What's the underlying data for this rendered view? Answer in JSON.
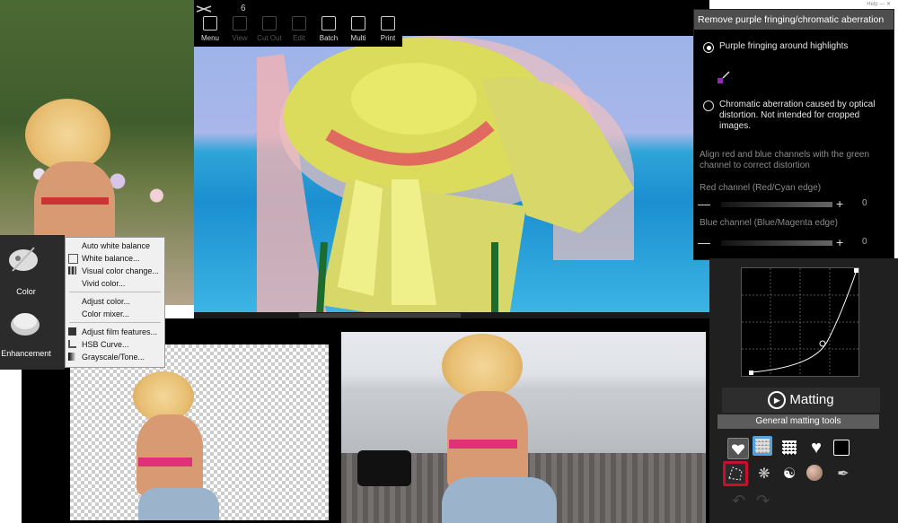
{
  "app": {
    "title": "6",
    "window_controls": [
      "Help",
      "—",
      "✕"
    ]
  },
  "toolbar": {
    "items": [
      {
        "label": "Menu",
        "icon": "menu-icon",
        "enabled": true
      },
      {
        "label": "View",
        "icon": "eye-icon",
        "enabled": false
      },
      {
        "label": "Cut Out",
        "icon": "heart-icon",
        "enabled": false
      },
      {
        "label": "Edit",
        "icon": "brush-icon",
        "enabled": false
      },
      {
        "label": "Batch",
        "icon": "batch-icon",
        "enabled": true
      },
      {
        "label": "Multi",
        "icon": "multi-icon",
        "enabled": true
      },
      {
        "label": "Print",
        "icon": "printer-icon",
        "enabled": true
      }
    ]
  },
  "dialog": {
    "title": "Remove purple fringing/chromatic aberration",
    "option1": "Purple fringing around highlights",
    "option2": "Chromatic aberration caused by optical distortion. Not intended for cropped images.",
    "option1_selected": true,
    "description": "Align red and blue channels with the green channel to correct distortion",
    "red_label": "Red channel (Red/Cyan edge)",
    "red_value": "0",
    "blue_label": "Blue channel (Blue/Magenta edge)",
    "blue_value": "0",
    "minus": "—",
    "plus": "+"
  },
  "menu": {
    "categories": [
      {
        "label": "Color",
        "icon": "palette-icon"
      },
      {
        "label": "Enhancement",
        "icon": "compact-icon"
      }
    ],
    "items": [
      {
        "label": "Auto white balance",
        "icon": ""
      },
      {
        "label": "White balance...",
        "icon": "white-balance-icon"
      },
      {
        "label": "Visual color change...",
        "icon": "grid-icon"
      },
      {
        "label": "Vivid color...",
        "icon": ""
      },
      {
        "label": "Adjust color...",
        "icon": ""
      },
      {
        "label": "Color mixer...",
        "icon": ""
      },
      {
        "label": "Adjust film features...",
        "icon": "film-icon"
      },
      {
        "label": "HSB Curve...",
        "icon": "curve-icon"
      },
      {
        "label": "Grayscale/Tone...",
        "icon": "tone-icon"
      }
    ]
  },
  "matting": {
    "button_label": "Matting",
    "header": "General matting tools",
    "tools_row1": [
      "heart-outline-icon",
      "checker-icon",
      "checker-dark-icon",
      "heart-icon",
      "square-icon"
    ],
    "tools_row2": [
      "lasso-icon",
      "blob-icon",
      "yin-yang-icon",
      "ball-icon",
      "feather-icon"
    ],
    "undo_redo": [
      "undo-icon",
      "redo-icon"
    ]
  },
  "colors": {
    "accent_selected": "#c8102e",
    "dialog_bg": "#000000",
    "title_bar": "#4e4e4e",
    "panel_bg": "#202020"
  }
}
